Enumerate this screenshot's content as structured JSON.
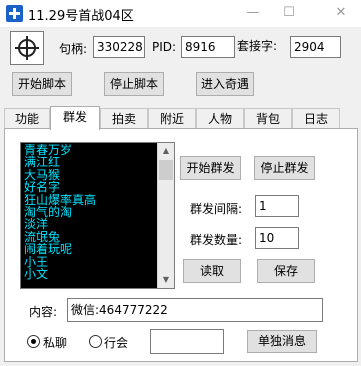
{
  "window": {
    "title": "11.29号首战04区",
    "minimize_glyph": "—",
    "maximize_glyph": "☐",
    "close_glyph": "✕"
  },
  "header": {
    "handle_label": "句柄:",
    "handle_value": "330228",
    "pid_label": "PID:",
    "pid_value": "8916",
    "socket_label": "套接字:",
    "socket_value": "2904"
  },
  "toolbar": {
    "start_script": "开始脚本",
    "stop_script": "停止脚本",
    "enter_encounter": "进入奇遇"
  },
  "tabs": [
    {
      "label": "功能"
    },
    {
      "label": "群发"
    },
    {
      "label": "拍卖"
    },
    {
      "label": "附近"
    },
    {
      "label": "人物"
    },
    {
      "label": "背包"
    },
    {
      "label": "日志"
    }
  ],
  "group_send": {
    "list_items": [
      "青春万岁",
      "满江红",
      "大马猴",
      "好名字",
      "狂山爆率真高",
      "淘气的淘",
      "淡洋",
      "流氓兔",
      "闹着玩呢",
      "小王",
      "小文"
    ],
    "start_label": "开始群发",
    "stop_label": "停止群发",
    "interval_label": "群发间隔:",
    "interval_value": "1",
    "count_label": "群发数量:",
    "count_value": "10",
    "read_label": "读取",
    "save_label": "保存",
    "content_label": "内容:",
    "content_value": "微信:464777222",
    "private_label": "私聊",
    "guild_label": "行会",
    "target_value": "",
    "single_label": "单独消息"
  }
}
